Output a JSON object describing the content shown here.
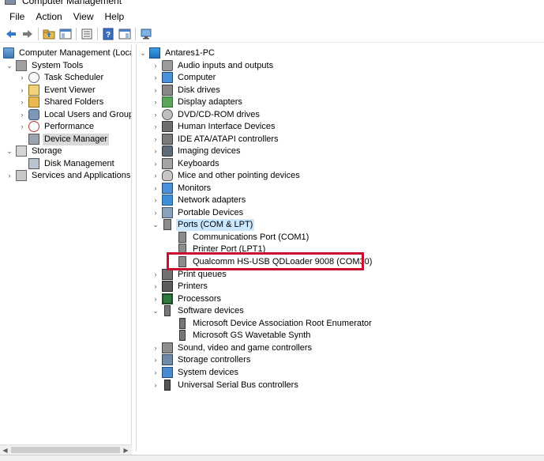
{
  "window": {
    "title": "Computer Management"
  },
  "menu": [
    "File",
    "Action",
    "View",
    "Help"
  ],
  "toolbar": {
    "buttons": [
      "back-icon",
      "forward-icon",
      "up-folder-icon",
      "show-tree-icon",
      "properties-icon",
      "help-icon",
      "show-action-pane-icon",
      "monitor-icon"
    ]
  },
  "left_tree": {
    "root": "Computer Management (Local",
    "system_tools": "System Tools",
    "items": [
      "Task Scheduler",
      "Event Viewer",
      "Shared Folders",
      "Local Users and Groups",
      "Performance",
      "Device Manager"
    ],
    "storage": "Storage",
    "disk_management": "Disk Management",
    "services": "Services and Applications"
  },
  "device_tree": {
    "root": "Antares1-PC",
    "categories": {
      "audio": "Audio inputs and outputs",
      "computer": "Computer",
      "disk_drives": "Disk drives",
      "display": "Display adapters",
      "dvd": "DVD/CD-ROM drives",
      "hid": "Human Interface Devices",
      "ide": "IDE ATA/ATAPI controllers",
      "imaging": "Imaging devices",
      "keyboards": "Keyboards",
      "mice": "Mice and other pointing devices",
      "monitors": "Monitors",
      "network": "Network adapters",
      "portable": "Portable Devices",
      "ports": "Ports (COM & LPT)",
      "print_queues": "Print queues",
      "printers": "Printers",
      "processors": "Processors",
      "software": "Software devices",
      "sound": "Sound, video and game controllers",
      "storage_ctl": "Storage controllers",
      "system_devices": "System devices",
      "usb": "Universal Serial Bus controllers"
    },
    "ports_children": [
      "Communications Port (COM1)",
      "Printer Port (LPT1)",
      "Qualcomm HS-USB QDLoader 9008 (COM30)"
    ],
    "software_children": [
      "Microsoft Device Association Root Enumerator",
      "Microsoft GS Wavetable Synth"
    ]
  },
  "highlight_color": "#c8102e",
  "selection_color": "#cce8ff"
}
